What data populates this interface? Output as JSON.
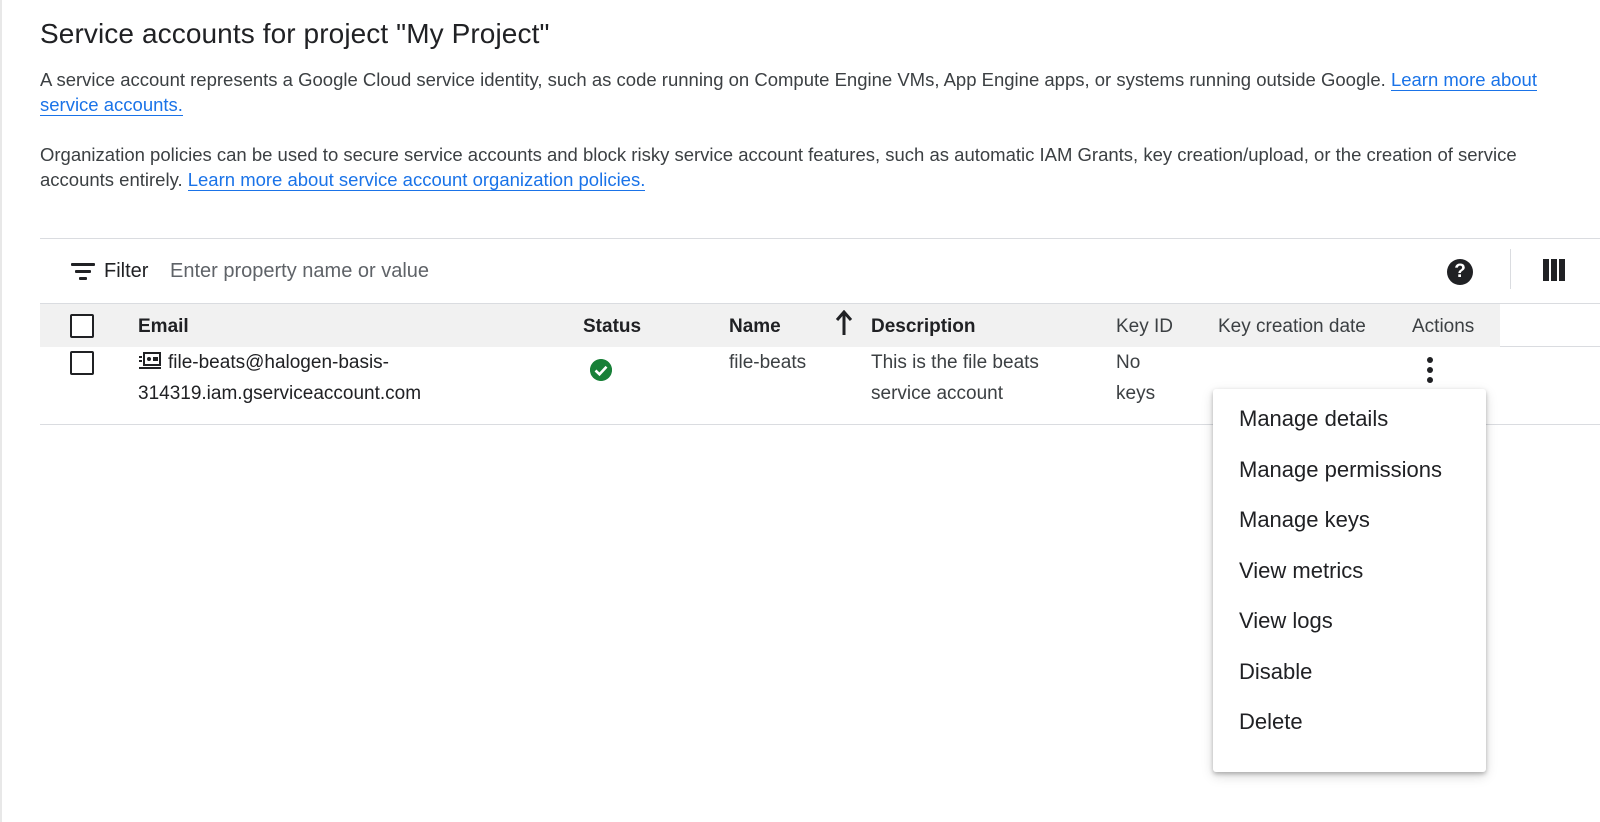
{
  "title": "Service accounts for project \"My Project\"",
  "intro": {
    "text": "A service account represents a Google Cloud service identity, such as code running on Compute Engine VMs, App Engine apps, or systems running outside Google. ",
    "link": "Learn more about service accounts."
  },
  "policy": {
    "text": "Organization policies can be used to secure service accounts and block risky service account features, such as automatic IAM Grants, key creation/upload, or the creation of service accounts entirely. ",
    "link": "Learn more about service account organization policies."
  },
  "filter": {
    "label": "Filter",
    "placeholder": "Enter property name or value",
    "icons": {
      "filter": "filter-icon",
      "help": "help-icon",
      "columns": "column-display-icon"
    },
    "help_glyph": "?"
  },
  "table": {
    "columns": [
      "Email",
      "Status",
      "Name",
      "Description",
      "Key ID",
      "Key creation date",
      "Actions"
    ],
    "sorted_column": "Name",
    "sort_direction": "ascending",
    "rows": [
      {
        "email_line1": "file-beats@halogen-basis-",
        "email_line2": "314319.iam.gserviceaccount.com",
        "status": "enabled",
        "status_icon": "check-circle-icon",
        "name": "file-beats",
        "description_line1": "This is the file beats",
        "description_line2": "service account",
        "key_id_line1": "No",
        "key_id_line2": "keys",
        "key_creation_date": ""
      }
    ]
  },
  "actions_menu": {
    "items": [
      "Manage details",
      "Manage permissions",
      "Manage keys",
      "View metrics",
      "View logs",
      "Disable",
      "Delete"
    ]
  },
  "colors": {
    "link": "#1a73e8",
    "status_ok": "#188038",
    "header_bg": "#f1f1f1"
  }
}
